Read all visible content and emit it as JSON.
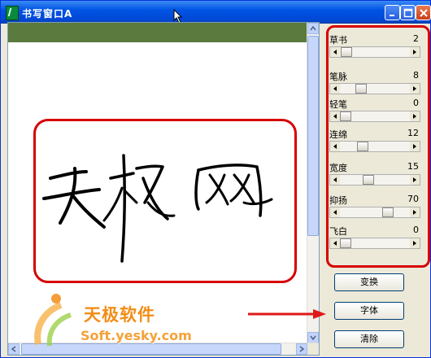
{
  "window": {
    "title": "书写窗口A"
  },
  "params": [
    {
      "label": "草书",
      "value": "2",
      "level": 0.02
    },
    {
      "label": "笔脉",
      "value": "8",
      "level": 0.25
    },
    {
      "label": "轻笔",
      "value": "0",
      "level": 0.0
    },
    {
      "label": "连绵",
      "value": "12",
      "level": 0.28
    },
    {
      "label": "宽度",
      "value": "15",
      "level": 0.38
    },
    {
      "label": "抑扬",
      "value": "70",
      "level": 0.7
    },
    {
      "label": "飞白",
      "value": "0",
      "level": 0.0
    }
  ],
  "buttons": {
    "transform": "变换",
    "font": "字体",
    "clear": "清除"
  },
  "watermark": {
    "brand": "天极软件",
    "site": "Soft.yesky.com"
  },
  "colors": {
    "annotation": "#d60000",
    "canvas_header": "#5a7a3e",
    "titlebar": "#0054e3",
    "watermark": "#f28d17"
  },
  "icons": [
    "app-icon",
    "minimize-icon",
    "maximize-icon",
    "close-icon",
    "mouse-cursor-icon",
    "scroll-up-icon",
    "scroll-down-icon",
    "scroll-left-icon",
    "scroll-right-icon",
    "yesky-logo-icon",
    "red-arrow-icon"
  ]
}
